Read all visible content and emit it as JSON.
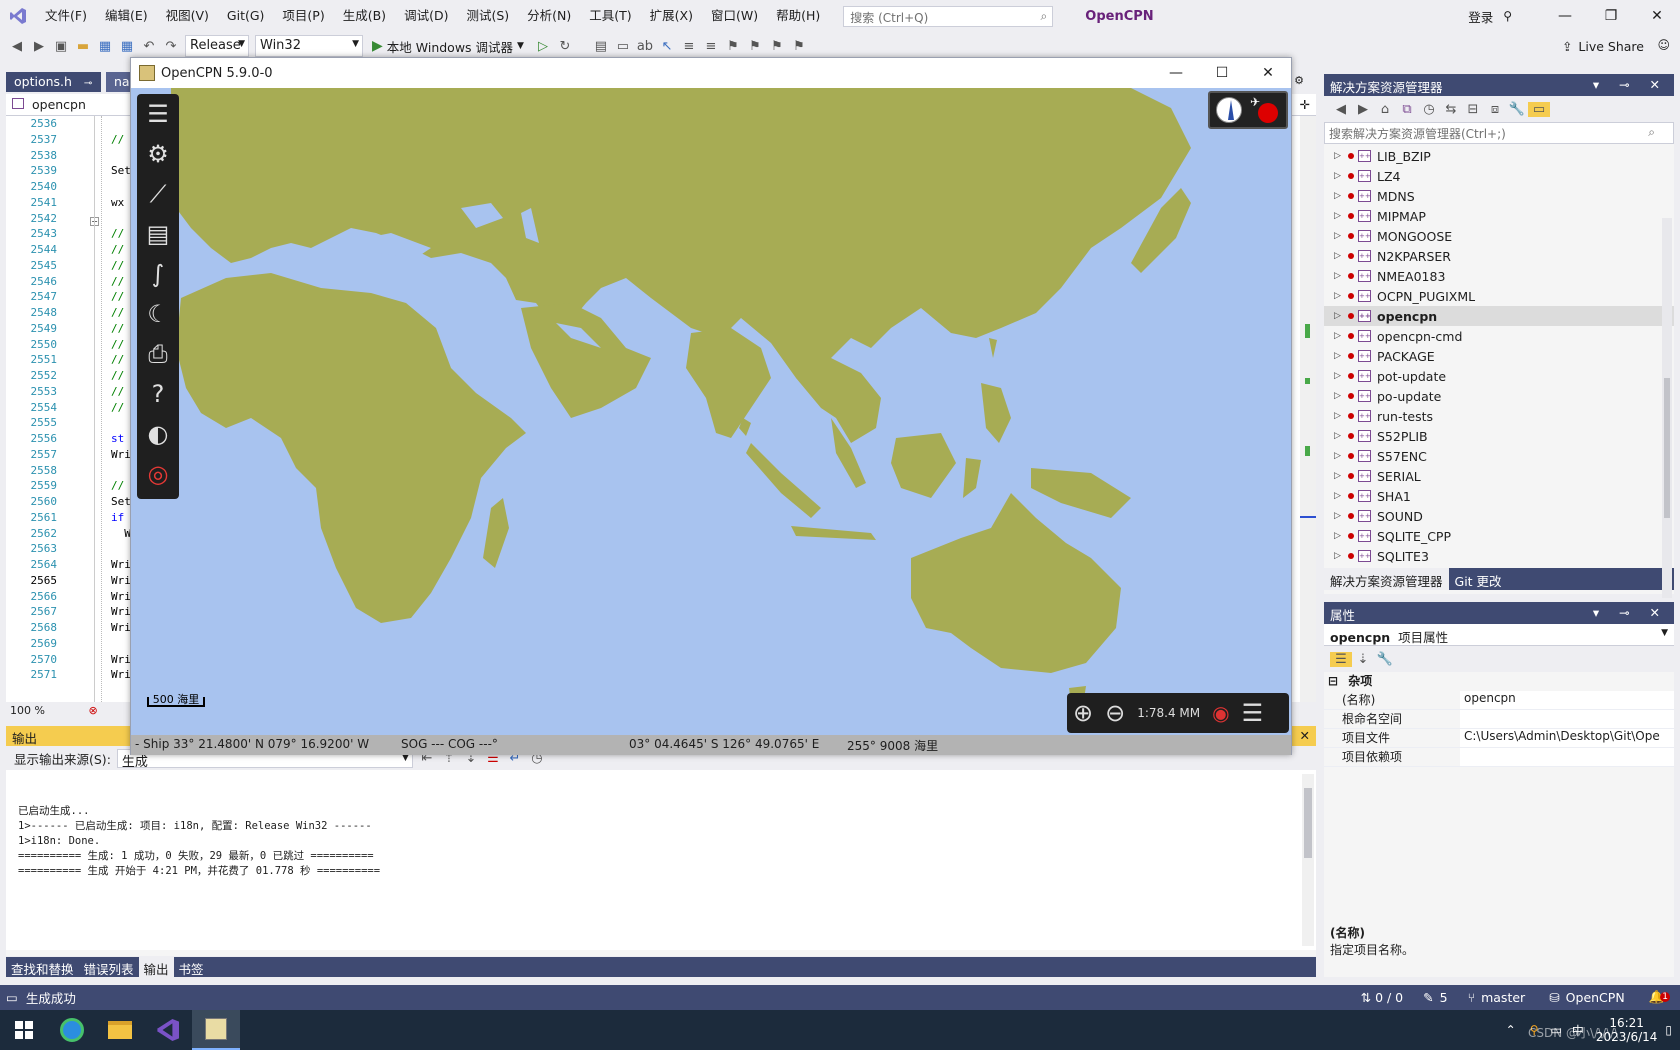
{
  "vs": {
    "menus": [
      "文件(F)",
      "编辑(E)",
      "视图(V)",
      "Git(G)",
      "项目(P)",
      "生成(B)",
      "调试(D)",
      "测试(S)",
      "分析(N)",
      "工具(T)",
      "扩展(X)",
      "窗口(W)",
      "帮助(H)"
    ],
    "search_placeholder": "搜索 (Ctrl+Q)",
    "solution_name": "OpenCPN",
    "signin": "登录",
    "config": "Release",
    "platform": "Win32",
    "run_label": "本地 Windows 调试器",
    "live_share": "Live Share"
  },
  "editor": {
    "tab_active": "options.h",
    "tab_second": "na",
    "nav_project": "opencpn",
    "zoom": "100 %",
    "line_numbers": [
      "2536",
      "2537",
      "2538",
      "2539",
      "2540",
      "2541",
      "2542",
      "2543",
      "2544",
      "2545",
      "2546",
      "2547",
      "2548",
      "2549",
      "2550",
      "2551",
      "2552",
      "2553",
      "2554",
      "2555",
      "2556",
      "2557",
      "2558",
      "2559",
      "2560",
      "2561",
      "2562",
      "2563",
      "2564",
      "2565",
      "2566",
      "2567",
      "2568",
      "2569",
      "2570",
      "2571"
    ],
    "code_lines": [
      "",
      "//",
      "",
      "Set",
      "",
      "wx",
      "",
      "//",
      "//",
      "//",
      "//",
      "//",
      "//",
      "//",
      "//",
      "//",
      "//",
      "//",
      "//",
      "",
      "st",
      "Wri",
      "",
      "//",
      "Set",
      "if",
      "  W",
      "",
      "Wri",
      "Wri",
      "Wri",
      "Wri",
      "Wri",
      "",
      "Wri",
      "Wri"
    ]
  },
  "ocpn": {
    "title": "OpenCPN 5.9.0-0",
    "scale_label": "500 海里",
    "zoom_scale": "1:78.4 MM",
    "status_ship": "- Ship 33° 21.4800' N   079° 16.9200' W",
    "status_sog": "SOG --- COG ---°",
    "status_cursor": "03° 04.4645' S   126° 49.0765' E",
    "status_brg": "255°  9008 海里"
  },
  "solution_explorer": {
    "title": "解决方案资源管理器",
    "search_placeholder": "搜索解决方案资源管理器(Ctrl+;)",
    "items": [
      "LIB_BZIP",
      "LZ4",
      "MDNS",
      "MIPMAP",
      "MONGOOSE",
      "N2KPARSER",
      "NMEA0183",
      "OCPN_PUGIXML",
      "opencpn",
      "opencpn-cmd",
      "PACKAGE",
      "pot-update",
      "po-update",
      "run-tests",
      "S52PLIB",
      "S57ENC",
      "SERIAL",
      "SHA1",
      "SOUND",
      "SQLITE_CPP",
      "SQLITE3"
    ],
    "selected": "opencpn",
    "tab1": "解决方案资源管理器",
    "tab2": "Git 更改"
  },
  "properties": {
    "title": "属性",
    "object": "opencpn",
    "object_type": "项目属性",
    "category": "杂项",
    "rows": [
      {
        "k": "(名称)",
        "v": "opencpn"
      },
      {
        "k": "根命名空间",
        "v": ""
      },
      {
        "k": "项目文件",
        "v": "C:\\Users\\Admin\\Desktop\\Git\\Ope"
      },
      {
        "k": "项目依赖项",
        "v": ""
      }
    ],
    "desc_title": "(名称)",
    "desc_text": "指定项目名称。"
  },
  "output": {
    "title": "输出",
    "source_label": "显示输出来源(S):",
    "source_value": "生成",
    "lines": [
      "已启动生成...",
      "1>------ 已启动生成: 项目: i18n, 配置: Release Win32 ------",
      "1>i18n: Done.",
      "========== 生成: 1 成功，0 失败，29 最新，0 已跳过 ==========",
      "========== 生成 开始于 4:21 PM，并花费了 01.778 秒 =========="
    ]
  },
  "bottom_tabs": [
    "查找和替换",
    "错误列表",
    "输出",
    "书签"
  ],
  "status": {
    "left": "生成成功",
    "lines": "0 / 0",
    "edits": "5",
    "branch": "master",
    "repo": "OpenCPN",
    "notifications": "1"
  },
  "taskbar": {
    "time": "16:21",
    "date": "2023/6/14",
    "ime": "中",
    "watermark": "CSDN @小\\/\\/\\/\\"
  },
  "colors": {
    "vs_blue": "#3f4a72",
    "sea": "#a8c3ef",
    "land": "#a7ac54"
  }
}
